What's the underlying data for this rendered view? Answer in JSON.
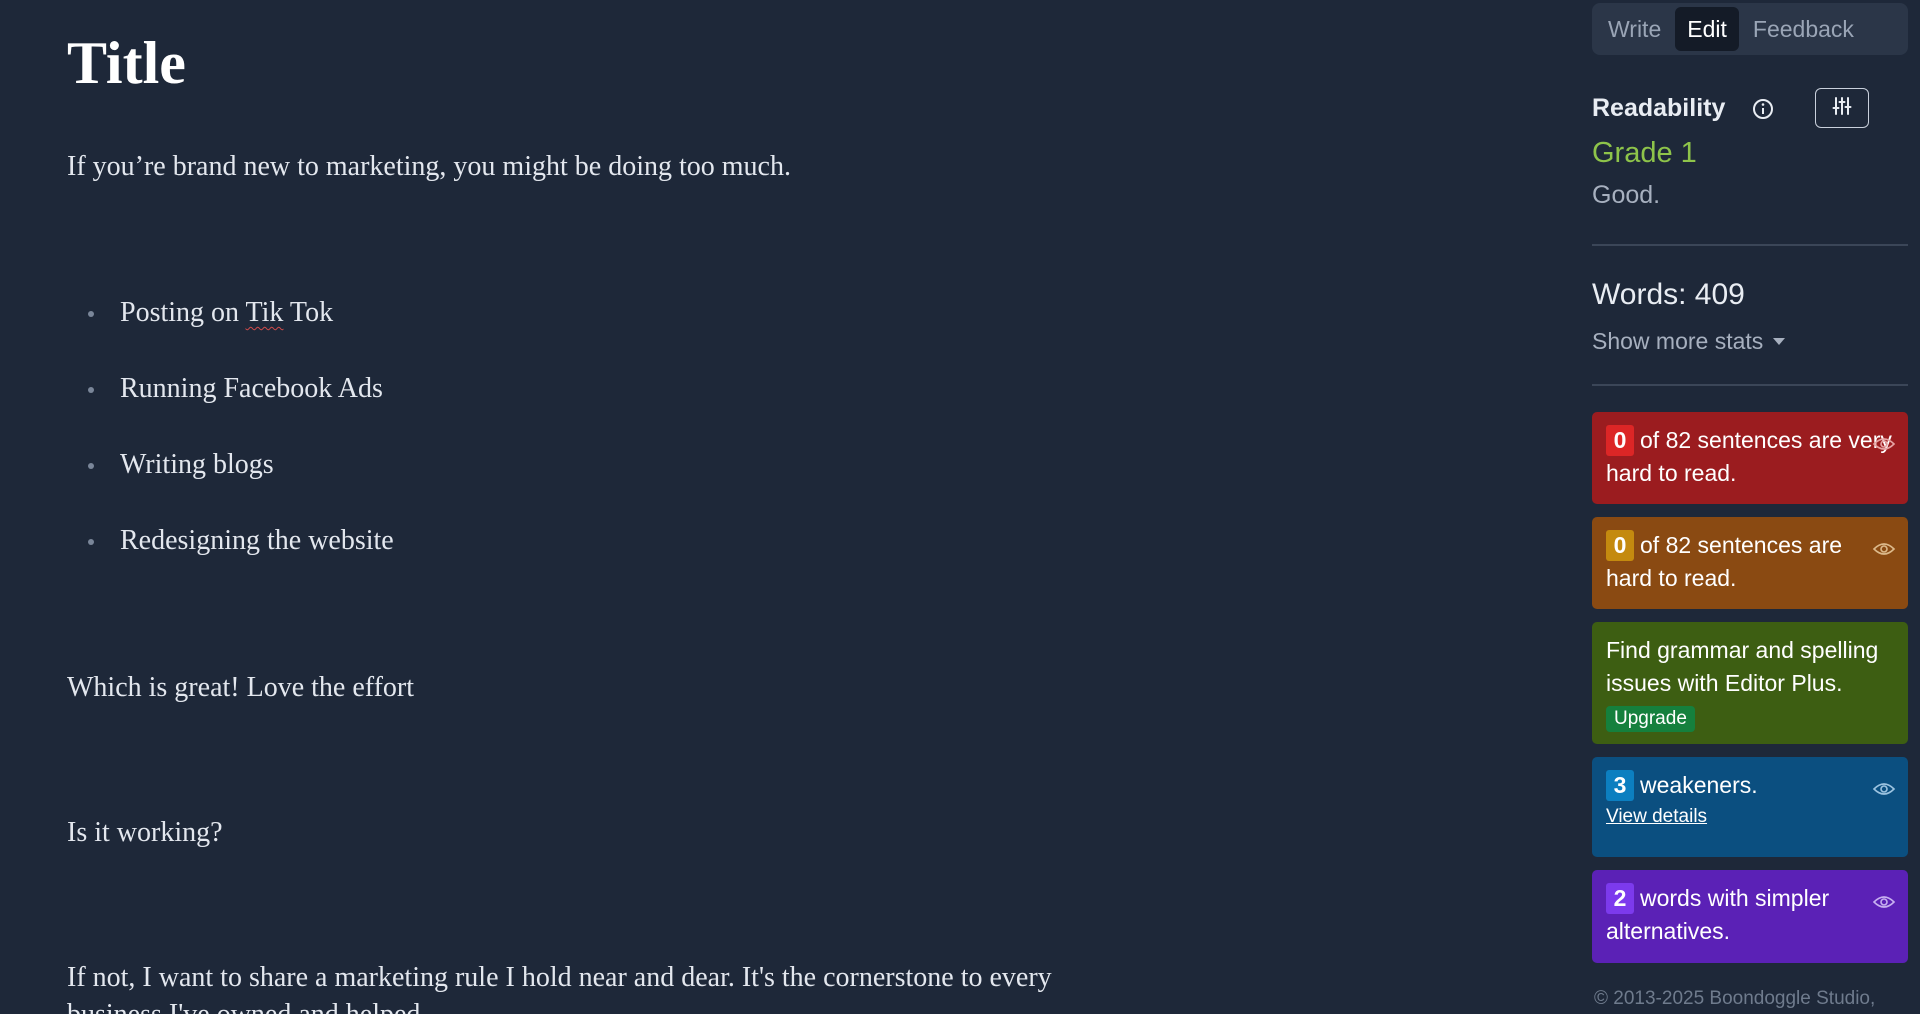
{
  "editor": {
    "title": "Title",
    "intro": "If you’re brand new to marketing, you might be doing too much.",
    "bullets": {
      "item1_before": "Posting on ",
      "item1_misspelled": "Tik",
      "item1_after": " Tok",
      "item2": "Running Facebook Ads",
      "item3": "Writing blogs",
      "item4": "Redesigning the website"
    },
    "para2": "Which is great! Love the effort",
    "para3": "Is it working?",
    "para4": "If not, I want to share a marketing rule I hold near and dear. It's the cornerstone to every",
    "para4_cont": "business I've owned and helped."
  },
  "sidebar": {
    "tabs": [
      "Write",
      "Edit",
      "Feedback"
    ],
    "active_tab": "Edit",
    "readability_label": "Readability",
    "grade": "Grade 1",
    "grade_description": "Good.",
    "grade_color": "#8ec44a",
    "words_label": "Words: 409",
    "show_more_stats": "Show more stats",
    "cards": {
      "very_hard": {
        "count": "0",
        "text": "of 82 sentences are very hard to read.",
        "color": "#9b1c1f"
      },
      "hard": {
        "count": "0",
        "text": "of 82 sentences are hard to read.",
        "color": "#8a4a12"
      },
      "grammar": {
        "text": "Find grammar and spelling issues with Editor Plus.",
        "button": "Upgrade",
        "color": "#3d5e12"
      },
      "weakeners": {
        "count": "3",
        "text": "weakeners.",
        "link": "View details",
        "color": "#0b4f80"
      },
      "simpler": {
        "count": "2",
        "text": "words with simpler alternatives.",
        "color": "#5b21b6"
      }
    },
    "footer": "© 2013-2025 Boondoggle Studio,"
  },
  "icons": [
    "info-icon",
    "sliders-icon",
    "eye-icon",
    "caret-down-icon"
  ]
}
